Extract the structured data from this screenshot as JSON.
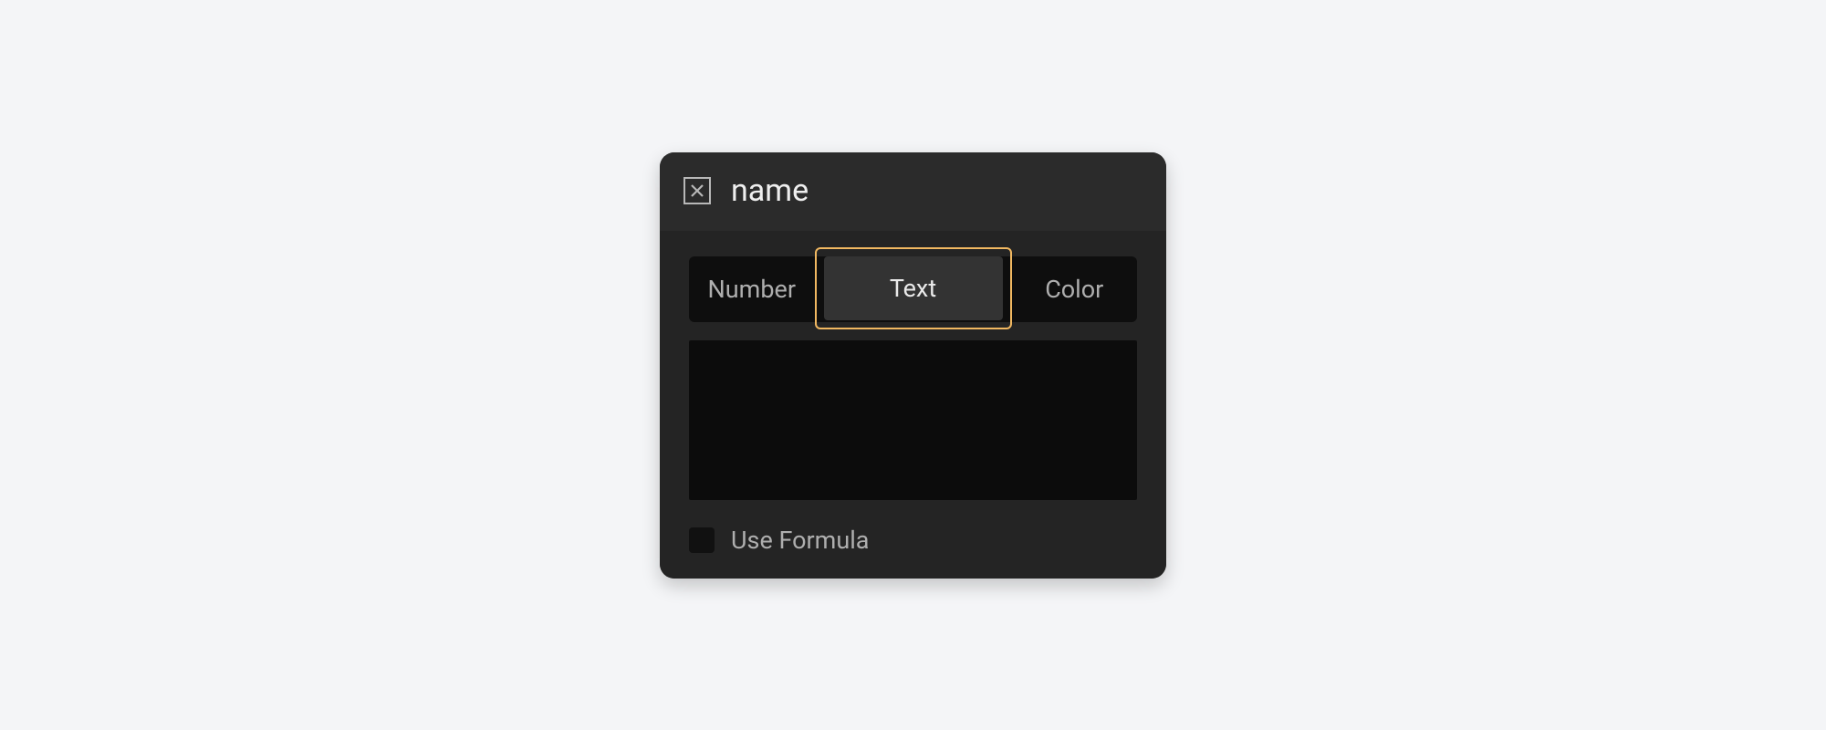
{
  "header": {
    "title": "name"
  },
  "tabs": {
    "items": [
      {
        "label": "Number"
      },
      {
        "label": "Text"
      },
      {
        "label": "Color"
      }
    ],
    "active_index": 1
  },
  "textarea": {
    "value": ""
  },
  "formula": {
    "label": "Use Formula",
    "checked": false
  }
}
